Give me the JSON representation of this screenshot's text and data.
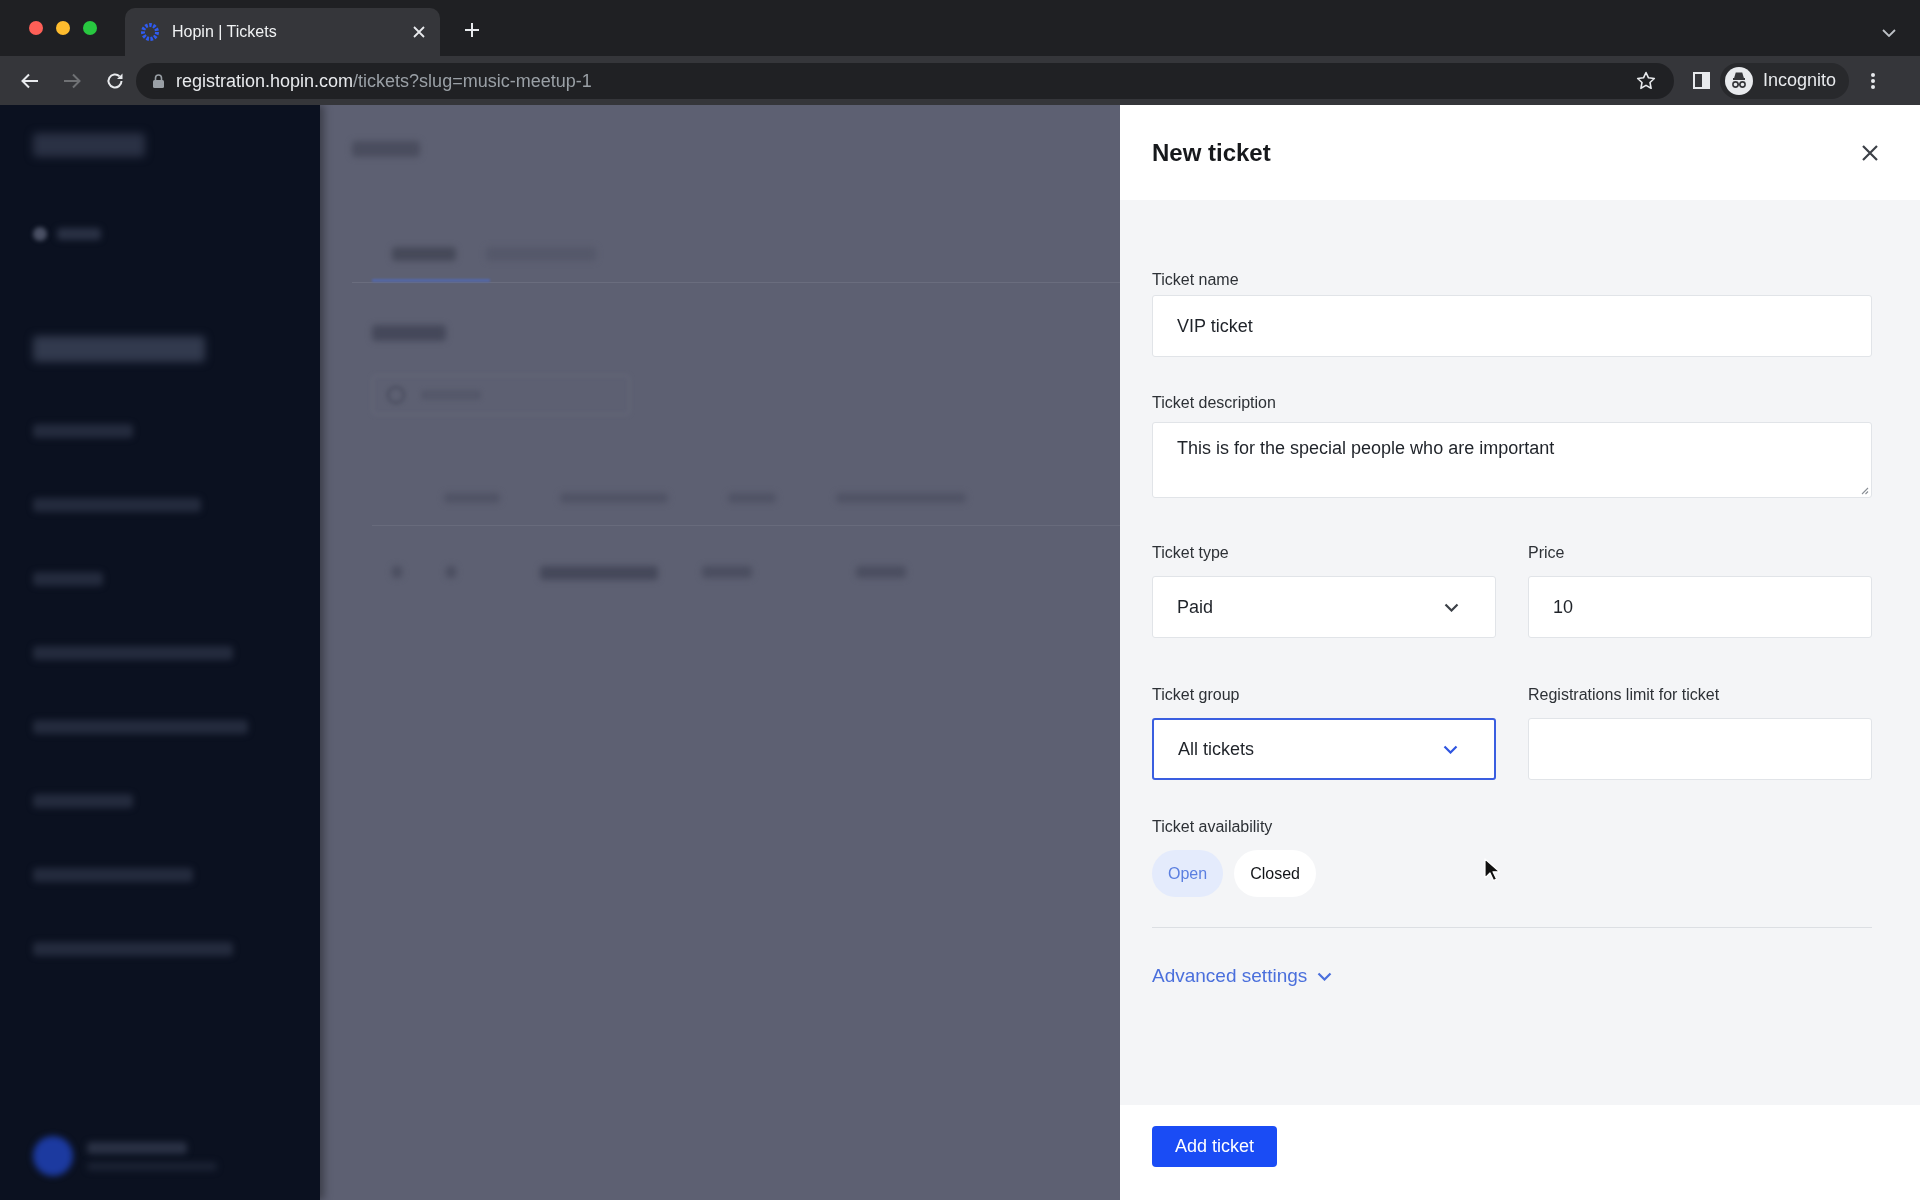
{
  "browser": {
    "tabs": [
      {
        "title": "Hopin | Tickets",
        "selected": true
      }
    ],
    "url": {
      "host": "registration.hopin.com",
      "path": "/tickets?slug=music-meetup-1"
    },
    "profile": "Incognito"
  },
  "panel": {
    "title": "New ticket",
    "rows": [
      [
        {
          "kind": "text",
          "label": "Ticket name",
          "value": "VIP ticket",
          "focused": false
        }
      ],
      [
        {
          "kind": "textarea",
          "label": "Ticket description",
          "value": "This is for the special people who are important",
          "focused": false
        }
      ],
      [
        {
          "kind": "select",
          "label": "Ticket type",
          "value": "Paid",
          "focused": false
        },
        {
          "kind": "text",
          "label": "Price",
          "value": "10",
          "focused": false
        }
      ],
      [
        {
          "kind": "select",
          "label": "Ticket group",
          "value": "All tickets",
          "focused": true
        },
        {
          "kind": "text",
          "label": "Registrations limit for ticket",
          "focused": false
        }
      ]
    ],
    "availability": {
      "label": "Ticket availability",
      "options": [
        {
          "label": "Open",
          "selected": true
        },
        {
          "label": "Closed",
          "selected": false
        }
      ]
    },
    "advanced_settings": {
      "label": "Advanced settings",
      "expanded": false
    },
    "submit": "Add ticket"
  }
}
